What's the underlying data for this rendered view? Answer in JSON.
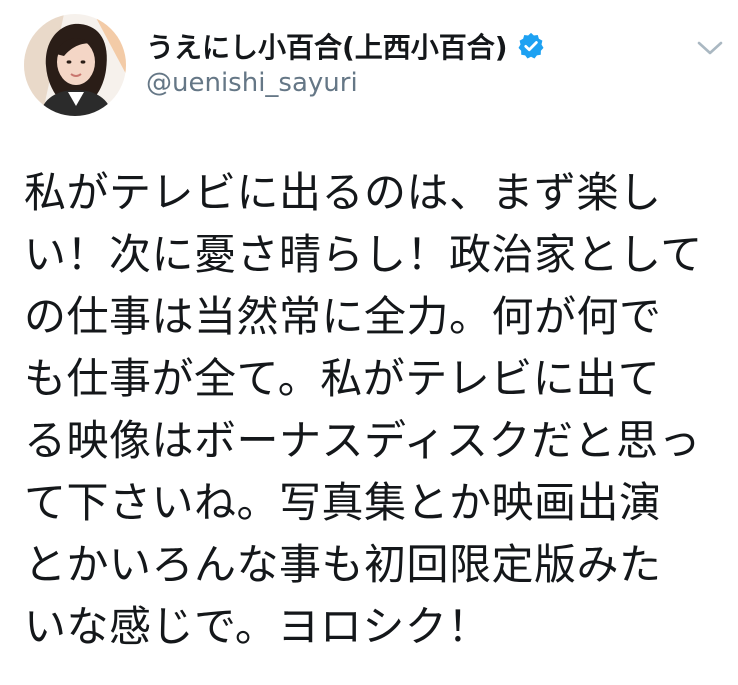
{
  "author": {
    "display_name": "うえにし小百合(上西小百合)",
    "handle": "@uenishi_sayuri",
    "verified": true,
    "avatar_icon": "profile-photo"
  },
  "tweet": {
    "lines": [
      "私がテレビに出るのは、まず楽し",
      "い！次に憂さ晴らし！政治家として",
      "の仕事は当然常に全力。何が何で",
      "も仕事が全て。私がテレビに出て",
      "る映像はボーナスディスクだと思っ",
      "て下さいね。写真集とか映画出演",
      "とかいろんな事も初回限定版みた",
      "いな感じで。ヨロシク！"
    ]
  },
  "colors": {
    "verified_badge": "#1da1f2",
    "handle_text": "#657786",
    "chevron": "#aab8c2"
  },
  "icons": {
    "verified": "verified-badge-icon",
    "menu": "chevron-down-icon"
  }
}
